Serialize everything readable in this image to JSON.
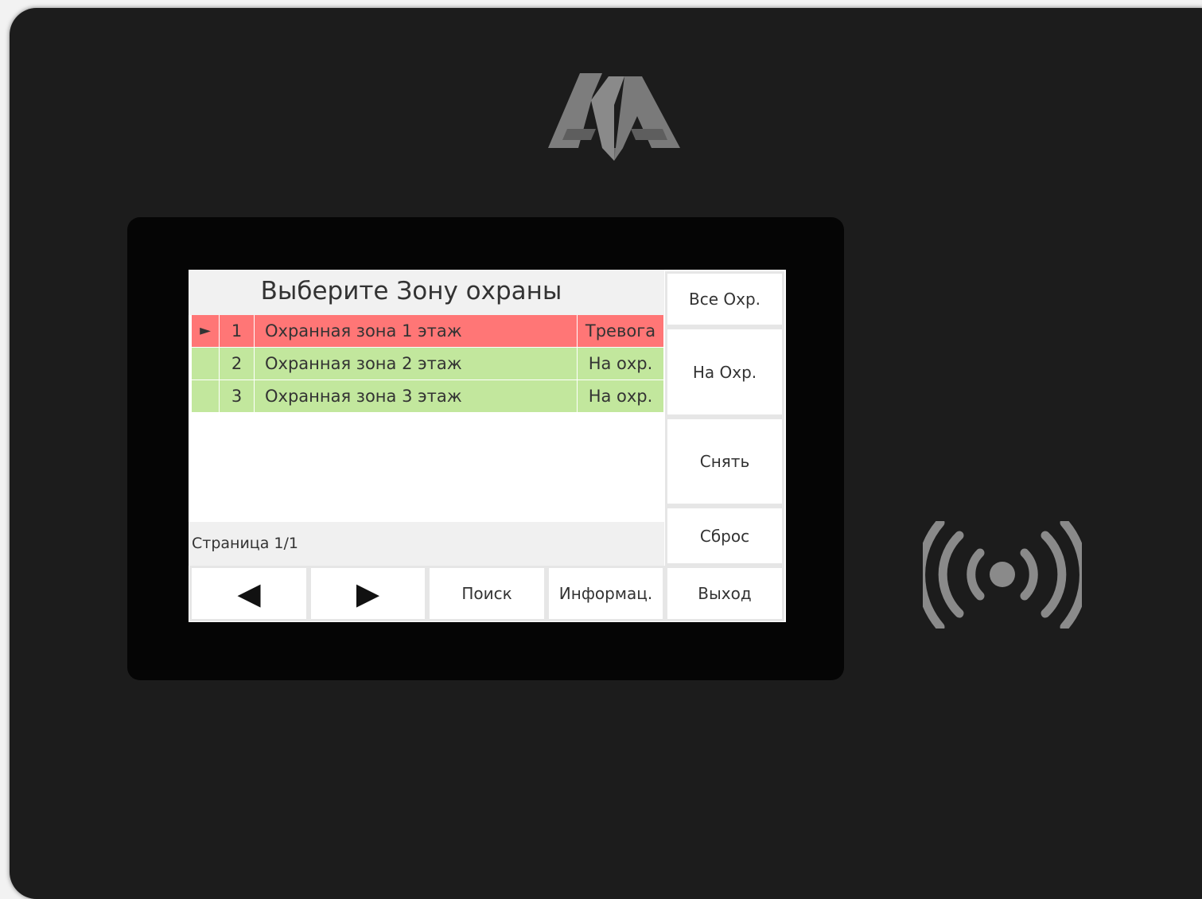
{
  "device": {
    "logo": "AA-logo",
    "rfid_icon": "rfid-wireless-icon"
  },
  "screen": {
    "title": "Выберите Зону охраны",
    "zones": [
      {
        "marker": "►",
        "number": "1",
        "name": "Охранная зона 1 этаж",
        "status": "Тревога",
        "status_color": "#ff7676"
      },
      {
        "marker": "",
        "number": "2",
        "name": "Охранная зона 2 этаж",
        "status": "На охр.",
        "status_color": "#c2e79d"
      },
      {
        "marker": "",
        "number": "3",
        "name": "Охранная зона 3 этаж",
        "status": "На охр.",
        "status_color": "#c2e79d"
      }
    ],
    "page_label": "Страница 1/1",
    "side_buttons": {
      "arm_all": "Все Охр.",
      "arm": "На Охр.",
      "disarm": "Снять",
      "reset": "Сброс"
    },
    "bottom_buttons": {
      "prev": "◀",
      "next": "▶",
      "search": "Поиск",
      "info": "Информац.",
      "exit": "Выход"
    }
  }
}
